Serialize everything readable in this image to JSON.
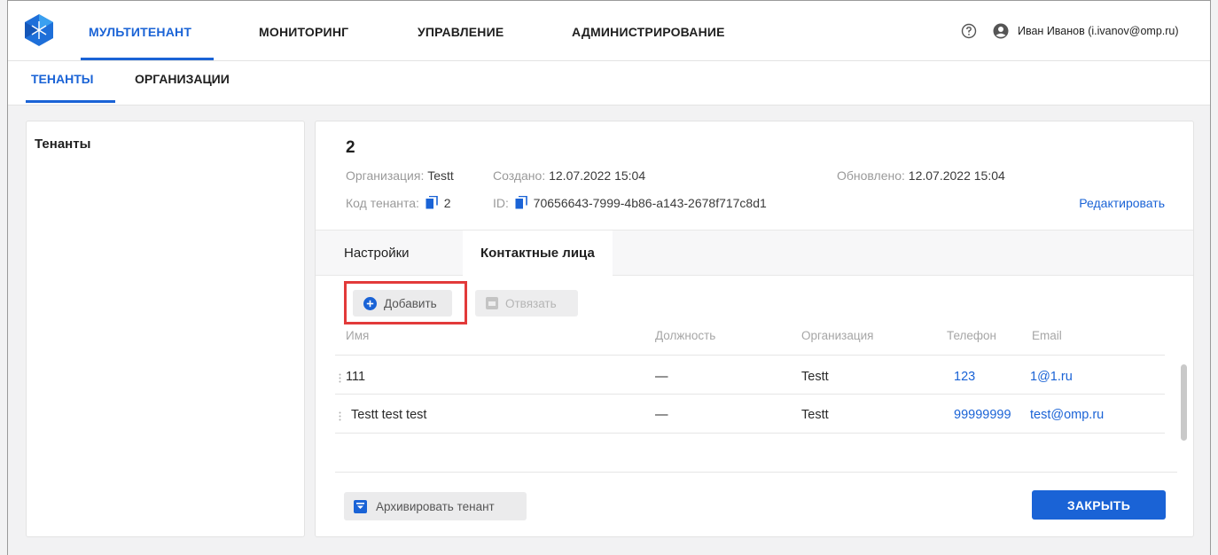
{
  "topnav": {
    "items": [
      {
        "label": "МУЛЬТИТЕНАНТ",
        "active": true
      },
      {
        "label": "МОНИТОРИНГ",
        "active": false
      },
      {
        "label": "УПРАВЛЕНИЕ",
        "active": false
      },
      {
        "label": "АДМИНИСТРИРОВАНИЕ",
        "active": false
      }
    ],
    "user_name": "Иван Иванов (i.ivanov@omp.ru)",
    "accent_color": "#1a63d6"
  },
  "subnav": {
    "items": [
      {
        "label": "ТЕНАНТЫ",
        "active": true
      },
      {
        "label": "ОРГАНИЗАЦИИ",
        "active": false
      }
    ]
  },
  "left_panel": {
    "title": "Тенанты"
  },
  "tenant": {
    "name": "2",
    "org_label": "Организация:",
    "org_value": "Testt",
    "created_label": "Создано:",
    "created_value": "12.07.2022 15:04",
    "updated_label": "Обновлено:",
    "updated_value": "12.07.2022 15:04",
    "code_label": "Код тенанта:",
    "code_value": "2",
    "id_label": "ID:",
    "id_value": "70656643-7999-4b86-a143-2678f717c8d1",
    "edit_label": "Редактировать"
  },
  "tabs": [
    {
      "label": "Настройки",
      "active": false
    },
    {
      "label": "Контактные лица",
      "active": true
    }
  ],
  "toolbar": {
    "add_label": "Добавить",
    "unbind_label": "Отвязать"
  },
  "table": {
    "columns": [
      "Имя",
      "Должность",
      "Организация",
      "Телефон",
      "Email"
    ],
    "rows": [
      {
        "name": "111",
        "position": "—",
        "organization": "Testt",
        "phone": "123",
        "email": "1@1.ru"
      },
      {
        "name": "Testt test test",
        "position": "—",
        "organization": "Testt",
        "phone": "99999999",
        "email": "test@omp.ru"
      }
    ]
  },
  "footer": {
    "archive_label": "Архивировать тенант",
    "close_label": "ЗАКРЫТЬ"
  }
}
